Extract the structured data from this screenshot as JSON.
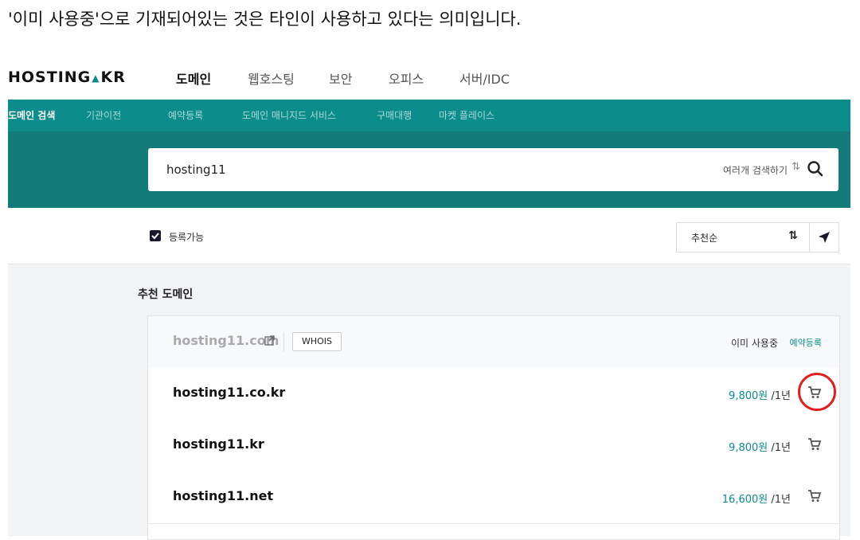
{
  "caption": "'이미 사용중'으로 기재되어있는 것은 타인이 사용하고 있다는 의미입니다.",
  "logo": {
    "text_left": "HOSTING",
    "text_right": "KR"
  },
  "nav": {
    "items": [
      {
        "label": "도메인",
        "active": true
      },
      {
        "label": "웹호스팅",
        "active": false
      },
      {
        "label": "보안",
        "active": false
      },
      {
        "label": "오피스",
        "active": false
      },
      {
        "label": "서버/IDC",
        "active": false
      }
    ]
  },
  "subnav": {
    "items": [
      {
        "label": "도메인 검색",
        "active": true
      },
      {
        "label": "기관이전",
        "active": false
      },
      {
        "label": "예약등록",
        "active": false
      },
      {
        "label": "도메인 매니지드 서비스",
        "active": false
      },
      {
        "label": "구매대행",
        "active": false
      },
      {
        "label": "마켓 플레이스",
        "active": false
      }
    ]
  },
  "search": {
    "value": "hosting11",
    "multi_label": "여러개 검색하기",
    "multi_icon": "⇅",
    "search_icon": "search-icon"
  },
  "filter": {
    "checkbox_label": "등록가능",
    "checked": true,
    "sort_label": "추천순",
    "sort_icon": "⇅"
  },
  "section": {
    "title": "추천 도메인"
  },
  "domains": [
    {
      "name": "hosting11.com",
      "used": true,
      "whois_label": "WHOIS",
      "status": "이미 사용중",
      "reserve_label": "예약등록"
    },
    {
      "name": "hosting11.co.kr",
      "used": false,
      "price": "9,800원",
      "period": "/1년",
      "highlight": true
    },
    {
      "name": "hosting11.kr",
      "used": false,
      "price": "9,800원",
      "period": "/1년"
    },
    {
      "name": "hosting11.net",
      "used": false,
      "price": "16,600원",
      "period": "/1년"
    }
  ],
  "colors": {
    "accent": "#0d8c8c",
    "band": "#147b7b",
    "highlight": "#e02020"
  }
}
